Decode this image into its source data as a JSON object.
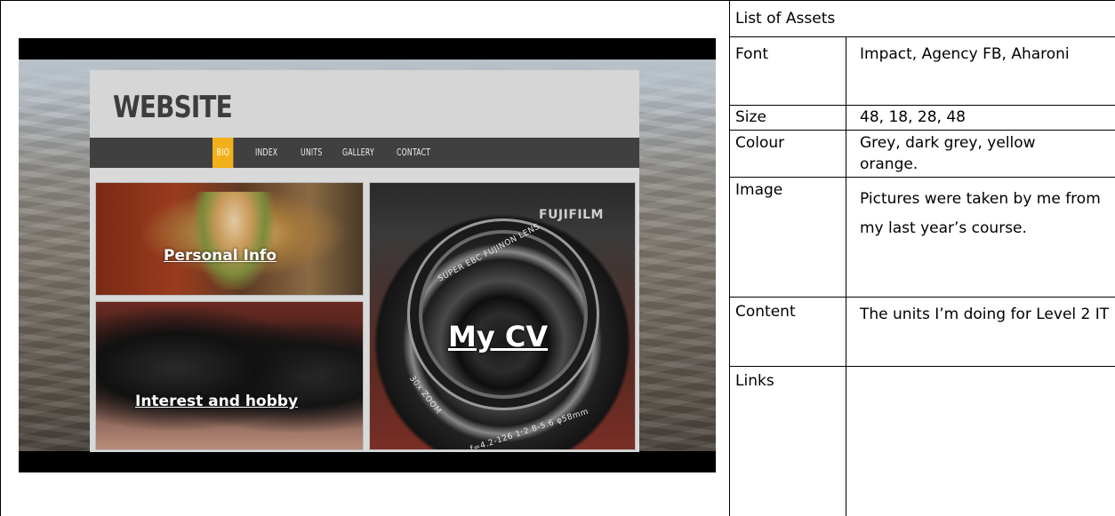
{
  "mockup": {
    "logo": "WEBSITE",
    "nav": [
      "BIO",
      "INDEX",
      "UNITS",
      "GALLERY",
      "CONTACT"
    ],
    "tiles": {
      "personal": "Personal Info",
      "hobby": "Interest and hobby",
      "cv": "My CV"
    },
    "lens": {
      "brand": "FUJIFILM",
      "ring": "SUPER EBC FUJINON LENS",
      "zoom": "30x ZOOM",
      "spec": "f=4.2-126  1:2.8-5.6  φ58mm"
    },
    "colors": {
      "nav_active": "#f2b01a",
      "nav_bar": "#404040",
      "header": "#d6d6d6"
    }
  },
  "assets": {
    "title": "List of Assets",
    "rows": [
      {
        "label": "Font",
        "value": "Impact, Agency FB, Aharoni"
      },
      {
        "label": "Size",
        "value": "48, 18, 28, 48"
      },
      {
        "label": "Colour",
        "value": "Grey, dark grey, yellow orange."
      },
      {
        "label": "Image",
        "value": "Pictures were taken by me from my last year’s course."
      },
      {
        "label": "Content",
        "value": "The units I’m doing for Level 2 IT"
      },
      {
        "label": "Links",
        "value": ""
      }
    ]
  }
}
